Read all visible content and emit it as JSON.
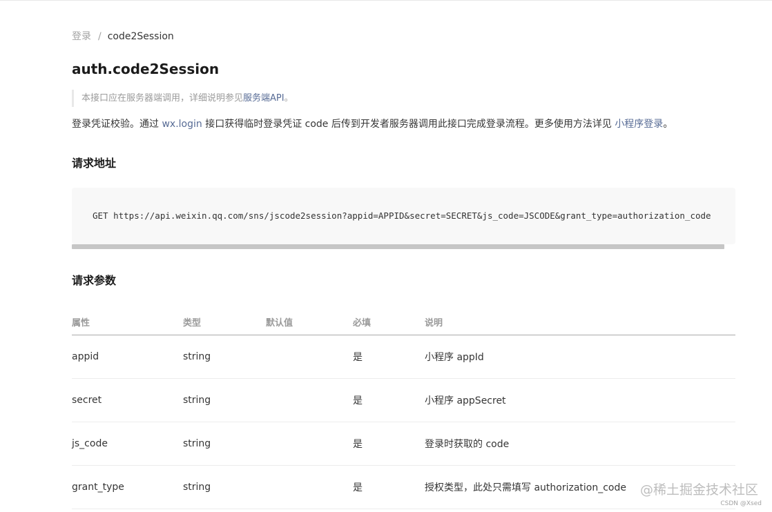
{
  "breadcrumb": {
    "root": "登录",
    "separator": "/",
    "current": "code2Session"
  },
  "page_title": "auth.code2Session",
  "notice": {
    "prefix": "本接口应在服务器端调用，详细说明参见",
    "link": "服务端API",
    "suffix": "。"
  },
  "intro": {
    "part1": "登录凭证校验。通过 ",
    "link1": "wx.login",
    "part2": " 接口获得临时登录凭证 code 后传到开发者服务器调用此接口完成登录流程。更多使用方法详见 ",
    "link2": "小程序登录",
    "part3": "。"
  },
  "request_url": {
    "title": "请求地址",
    "code": "GET https://api.weixin.qq.com/sns/jscode2session?appid=APPID&secret=SECRET&js_code=JSCODE&grant_type=authorization_code"
  },
  "request_params": {
    "title": "请求参数",
    "headers": {
      "prop": "属性",
      "type": "类型",
      "default": "默认值",
      "required": "必填",
      "desc": "说明"
    },
    "rows": [
      {
        "prop": "appid",
        "type": "string",
        "default": "",
        "required": "是",
        "desc": "小程序 appId"
      },
      {
        "prop": "secret",
        "type": "string",
        "default": "",
        "required": "是",
        "desc": "小程序 appSecret"
      },
      {
        "prop": "js_code",
        "type": "string",
        "default": "",
        "required": "是",
        "desc": "登录时获取的 code"
      },
      {
        "prop": "grant_type",
        "type": "string",
        "default": "",
        "required": "是",
        "desc": "授权类型，此处只需填写 authorization_code"
      }
    ]
  },
  "watermark": {
    "text": "@稀土掘金技术社区",
    "sub": "CSDN @Xsed"
  },
  "colors": {
    "link": "#576b95",
    "muted": "#9a9a9a",
    "code_bg": "#f8f8f8"
  }
}
